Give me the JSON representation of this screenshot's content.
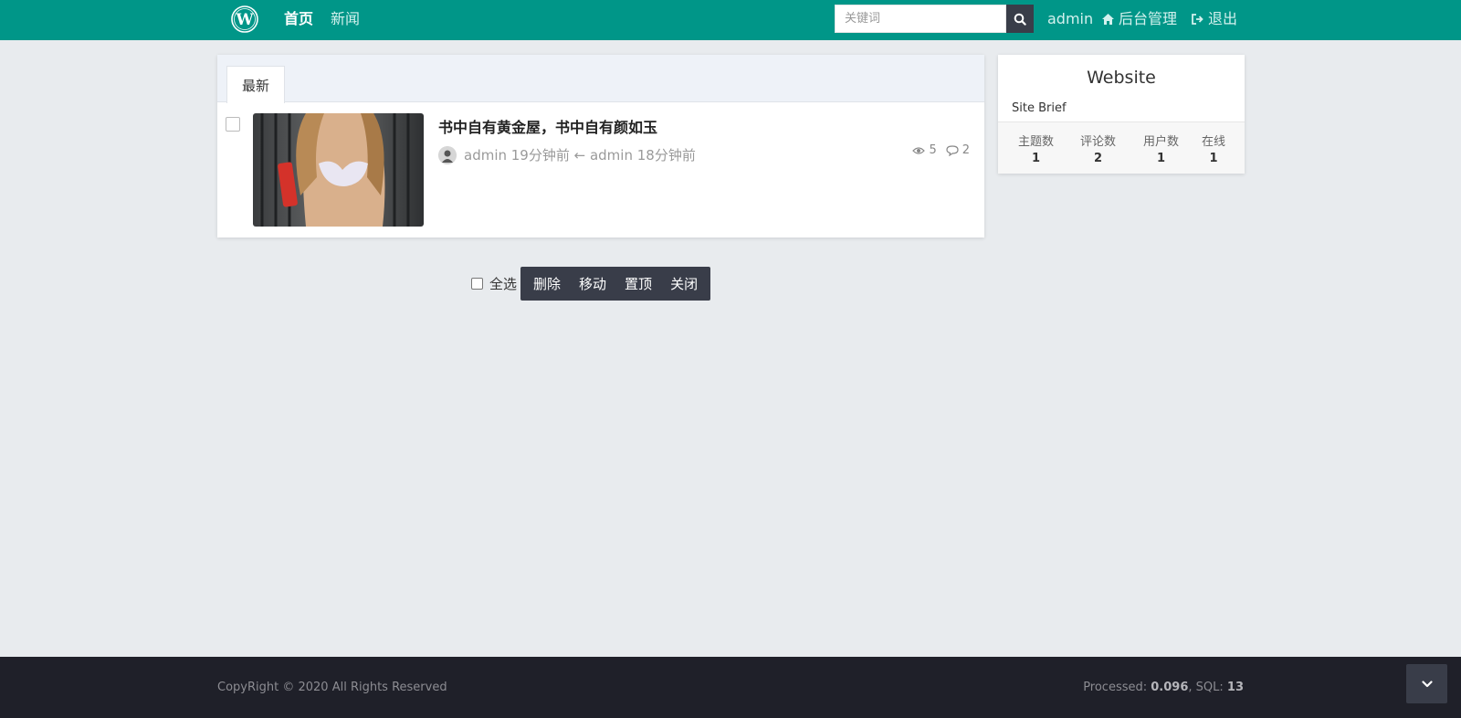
{
  "header": {
    "logo_icon": "wordpress-logo-icon",
    "nav": [
      {
        "label": "首页",
        "active": true
      },
      {
        "label": "新闻",
        "active": false
      }
    ],
    "search": {
      "placeholder": "关键词",
      "icon": "search-icon"
    },
    "user": "admin",
    "admin_link": "后台管理",
    "logout": "退出"
  },
  "main": {
    "tab": "最新",
    "post": {
      "title": "书中自有黄金屋，书中自有颜如玉",
      "meta": "admin 19分钟前 ← admin 18分钟前",
      "views": "5",
      "comments": "2"
    }
  },
  "batch": {
    "select_all": "全选",
    "buttons": [
      "删除",
      "移动",
      "置顶",
      "关闭"
    ]
  },
  "sidebar": {
    "title": "Website",
    "brief": "Site Brief",
    "stats": [
      {
        "label": "主题数",
        "value": "1"
      },
      {
        "label": "评论数",
        "value": "2"
      },
      {
        "label": "用户数",
        "value": "1"
      },
      {
        "label": "在线",
        "value": "1"
      }
    ]
  },
  "footer": {
    "copyright": "CopyRight © 2020 All Rights Reserved",
    "processed_label": "Processed: ",
    "processed_value": "0.096",
    "sql_label": ", SQL: ",
    "sql_value": "13"
  },
  "colors": {
    "header": "#009688",
    "dark": "#393d49",
    "footer": "#1f2029"
  }
}
